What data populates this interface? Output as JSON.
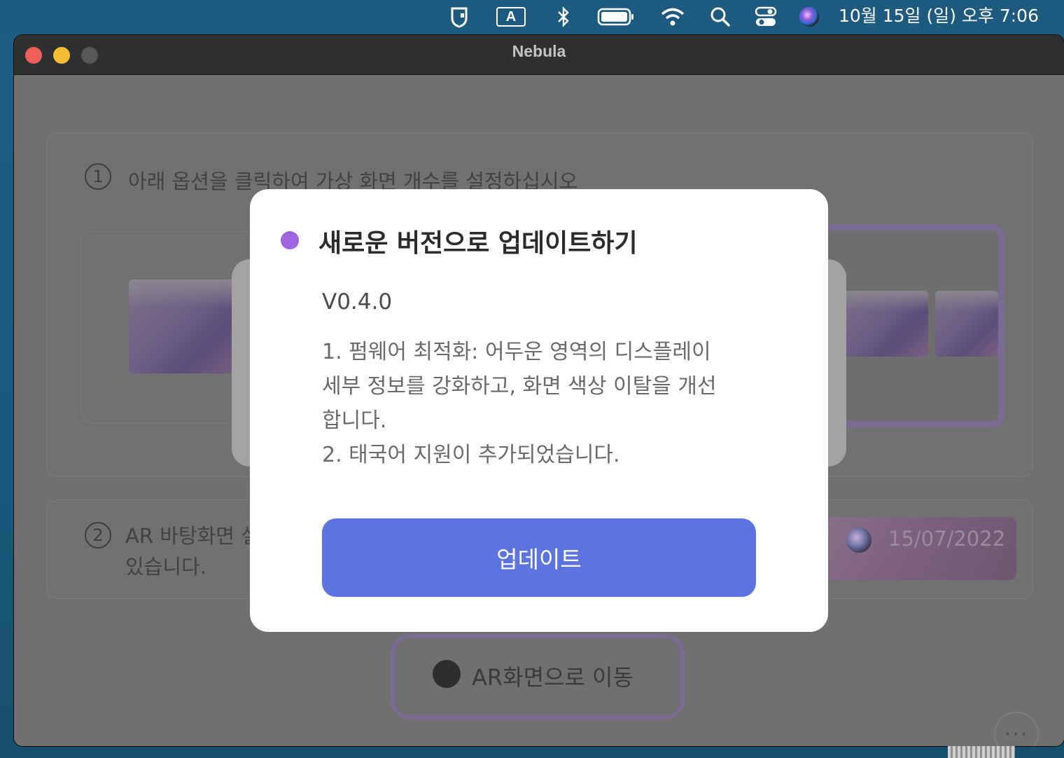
{
  "menubar": {
    "input_source_label": "A",
    "clock": "10월 15일 (일) 오후 7:06",
    "icons": [
      "shield-app-icon",
      "input-source-icon",
      "bluetooth-icon",
      "battery-icon",
      "wifi-icon",
      "search-icon",
      "control-center-icon",
      "siri-icon"
    ]
  },
  "window": {
    "title": "Nebula"
  },
  "background": {
    "step1_number": "1",
    "step1_text": "아래 옵션을 클릭하여 가상 화면 개수를 설정하십시오",
    "step2_number": "2",
    "step2_text_line1": "AR 바탕화면 설",
    "step2_text_line2": "있습니다.",
    "date_label": "15/07/2022",
    "ar_button_label": "AR화면으로 이동",
    "more_label": "···"
  },
  "dialog": {
    "title": "새로운 버전으로 업데이트하기",
    "version": "V0.4.0",
    "notes": [
      "1. 펌웨어 최적화: 어두운 영역의 디스플레이",
      "세부 정보를 강화하고, 화면 색상 이탈을 개선",
      "합니다.",
      "2. 태국어 지원이 추가되었습니다."
    ],
    "update_button": "업데이트",
    "accent_color": "#a064de",
    "button_color": "#5b74e0"
  }
}
